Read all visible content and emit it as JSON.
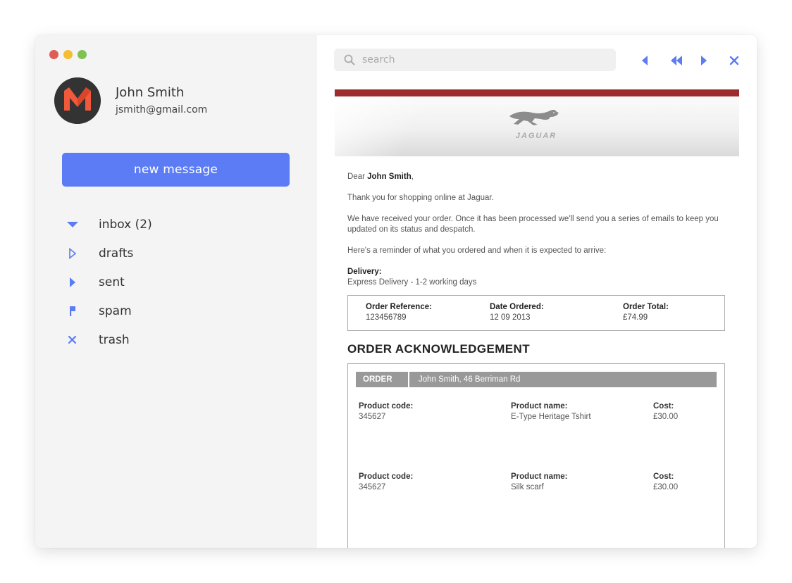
{
  "colors": {
    "accent": "#5b7cf5",
    "brand_red": "#9e2b2e",
    "sidebar_bg": "#f4f4f4"
  },
  "traffic_lights": [
    "#e05d56",
    "#f5bd33",
    "#7ec34f"
  ],
  "user": {
    "name": "John Smith",
    "email": "jsmith@gmail.com",
    "avatar_icon": "m-logo-icon"
  },
  "compose": {
    "label": "new message"
  },
  "folders": [
    {
      "label": "inbox (2)",
      "icon": "caret-down-icon"
    },
    {
      "label": "drafts",
      "icon": "caret-right-outline-icon"
    },
    {
      "label": "sent",
      "icon": "caret-right-icon"
    },
    {
      "label": "spam",
      "icon": "flag-icon"
    },
    {
      "label": "trash",
      "icon": "close-icon"
    }
  ],
  "search": {
    "placeholder": "search"
  },
  "toolbar": {
    "icons": [
      "reply-icon",
      "reply-all-icon",
      "forward-icon",
      "close-icon"
    ]
  },
  "email": {
    "brand": "JAGUAR",
    "greeting_prefix": "Dear ",
    "greeting_name": "John Smith",
    "greeting_suffix": ",",
    "paragraphs": [
      "Thank you for shopping online at Jaguar.",
      "We have received your order. Once it has been processed we'll send you a series of emails to keep you updated on its status and despatch.",
      "Here's a reminder of what you ordered and when it is expected to arrive:"
    ],
    "delivery": {
      "title": "Delivery:",
      "value": "Express Delivery - 1-2 working days"
    },
    "summary": [
      {
        "label": "Order Reference:",
        "value": "123456789"
      },
      {
        "label": "Date Ordered:",
        "value": "12 09 2013"
      },
      {
        "label": "Order Total:",
        "value": "£74.99"
      }
    ],
    "ack_title": "ORDER ACKNOWLEDGEMENT",
    "order": {
      "tag": "ORDER",
      "address": "John Smith, 46 Berriman Rd",
      "col_labels": {
        "code": "Product code:",
        "name": "Product name:",
        "cost": "Cost:"
      },
      "items": [
        {
          "code": "345627",
          "name": "E-Type Heritage Tshirt",
          "cost": "£30.00"
        },
        {
          "code": "345627",
          "name": "Silk scarf",
          "cost": "£30.00"
        }
      ]
    }
  }
}
